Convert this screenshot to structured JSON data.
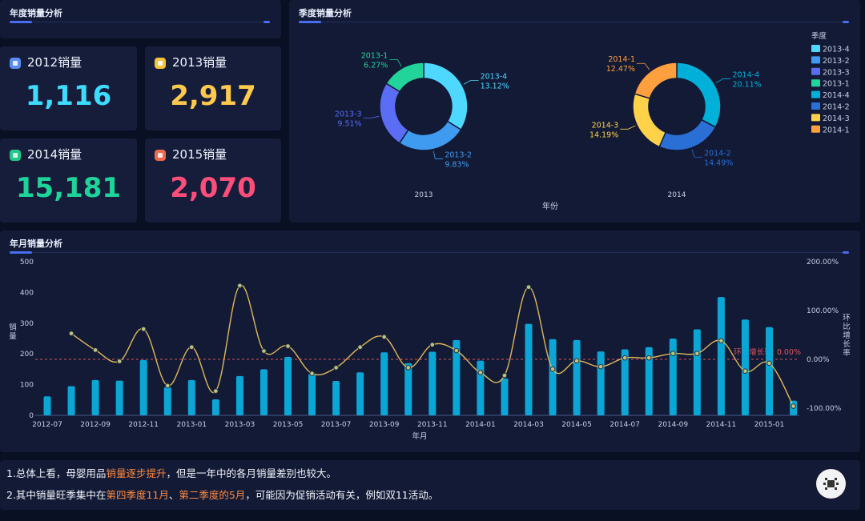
{
  "panels": {
    "yearly_title": "年度销量分析",
    "quarterly_title": "季度销量分析",
    "monthly_title": "年月销量分析"
  },
  "cards": [
    {
      "label": "2012销量",
      "value": "1,116",
      "color": "#3ddcff",
      "icon": "chart-icon",
      "icon_color": "#5b8def"
    },
    {
      "label": "2013销量",
      "value": "2,917",
      "color": "#ffc94d",
      "icon": "chat-icon",
      "icon_color": "#f5c33b"
    },
    {
      "label": "2014销量",
      "value": "15,181",
      "color": "#1ed49a",
      "icon": "file-icon",
      "icon_color": "#21c98a"
    },
    {
      "label": "2015销量",
      "value": "2,070",
      "color": "#ff4d7a",
      "icon": "image-icon",
      "icon_color": "#ef6a4b"
    }
  ],
  "notes": {
    "line1_a": "1.总体上看，母婴用品",
    "line1_b": "销量逐步提升",
    "line1_c": "，但是一年中的各月销量差别也较大。",
    "line2_a": "2.其中销量旺季集中在",
    "line2_b": "第四季度11月",
    "line2_c": "、",
    "line2_d": "第二季度的5月",
    "line2_e": "，可能因为促销活动有关，例如双11活动。"
  },
  "chart_data": [
    {
      "type": "pie",
      "subtype": "donut",
      "xlabel": "年份",
      "legend_title": "季度",
      "legend_position": "right",
      "legend": [
        {
          "name": "2013-4",
          "color": "#4fd8ff"
        },
        {
          "name": "2013-2",
          "color": "#3f9bf0"
        },
        {
          "name": "2013-3",
          "color": "#5b6cf5"
        },
        {
          "name": "2013-1",
          "color": "#21d49a"
        },
        {
          "name": "2014-4",
          "color": "#00b0d8"
        },
        {
          "name": "2014-2",
          "color": "#2a6fd6"
        },
        {
          "name": "2014-3",
          "color": "#ffd24a"
        },
        {
          "name": "2014-1",
          "color": "#ff9f3d"
        }
      ],
      "pies": [
        {
          "category": "2013",
          "slices": [
            {
              "name": "2013-4",
              "value": 13.12,
              "label": "13.12%",
              "color": "#4fd8ff"
            },
            {
              "name": "2013-2",
              "value": 9.83,
              "label": "9.83%",
              "color": "#3f9bf0"
            },
            {
              "name": "2013-3",
              "value": 9.51,
              "label": "9.51%",
              "color": "#5b6cf5"
            },
            {
              "name": "2013-1",
              "value": 6.27,
              "label": "6.27%",
              "color": "#21d49a"
            }
          ]
        },
        {
          "category": "2014",
          "slices": [
            {
              "name": "2014-4",
              "value": 20.11,
              "label": "20.11%",
              "color": "#00b0d8"
            },
            {
              "name": "2014-2",
              "value": 14.49,
              "label": "14.49%",
              "color": "#2a6fd6"
            },
            {
              "name": "2014-3",
              "value": 14.19,
              "label": "14.19%",
              "color": "#ffd24a"
            },
            {
              "name": "2014-1",
              "value": 12.47,
              "label": "12.47%",
              "color": "#ff9f3d"
            }
          ]
        }
      ]
    },
    {
      "type": "bar",
      "xlabel": "年月",
      "ylabel": "销量",
      "y2label": "环比增长率",
      "ylim": [
        0,
        500
      ],
      "yticks": [
        0,
        100,
        200,
        300,
        400,
        500
      ],
      "y2lim": [
        -100,
        200
      ],
      "y2ticks": [
        "-100.00%",
        "0.00%",
        "100.00%",
        "200.00%"
      ],
      "reference_line": {
        "label": "环比增长率: 0.00%",
        "value": 0,
        "color": "#e0555a"
      },
      "bar_color": "#0aa6d6",
      "line_color": "#e0b85a",
      "x_tick_labels": [
        "2012-07",
        "2012-09",
        "2012-11",
        "2013-01",
        "2013-03",
        "2013-05",
        "2013-07",
        "2013-09",
        "2013-11",
        "2014-01",
        "2014-03",
        "2014-05",
        "2014-07",
        "2014-09",
        "2014-11",
        "2015-01"
      ],
      "categories": [
        "2012-07",
        "2012-08",
        "2012-09",
        "2012-10",
        "2012-11",
        "2012-12",
        "2013-01",
        "2013-02",
        "2013-03",
        "2013-04",
        "2013-05",
        "2013-06",
        "2013-07",
        "2013-08",
        "2013-09",
        "2013-10",
        "2013-11",
        "2013-12",
        "2014-01",
        "2014-02",
        "2014-03",
        "2014-04",
        "2014-05",
        "2014-06",
        "2014-07",
        "2014-08",
        "2014-09",
        "2014-10",
        "2014-11",
        "2014-12",
        "2015-01",
        "2015-02"
      ],
      "series": [
        {
          "name": "销量",
          "type": "bar",
          "values": [
            62,
            95,
            115,
            113,
            180,
            92,
            115,
            52,
            128,
            150,
            190,
            135,
            112,
            140,
            205,
            170,
            207,
            245,
            178,
            120,
            298,
            248,
            245,
            208,
            215,
            222,
            250,
            280,
            385,
            312,
            287,
            48
          ]
        },
        {
          "name": "环比增长率",
          "type": "line",
          "values": [
            null,
            53,
            19,
            -4,
            62,
            -54,
            25,
            -65,
            151,
            17,
            27,
            -29,
            -17,
            25,
            46,
            -17,
            30,
            18,
            -27,
            -33,
            148,
            -20,
            -3,
            -15,
            3,
            3,
            12,
            12,
            38,
            -24,
            -8,
            -96
          ]
        }
      ]
    }
  ]
}
